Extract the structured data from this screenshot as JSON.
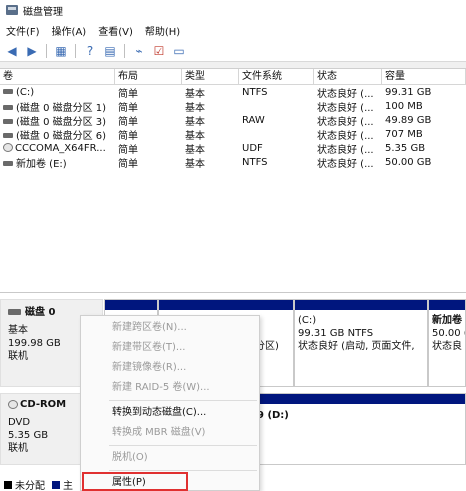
{
  "window": {
    "title": "磁盘管理"
  },
  "menu": [
    "文件(F)",
    "操作(A)",
    "查看(V)",
    "帮助(H)"
  ],
  "toolbar": {
    "icons": [
      "back-arrow-icon",
      "forward-arrow-icon",
      "disk-list-icon",
      "help-icon",
      "properties-icon",
      "connect-icon",
      "checkmark-icon",
      "window-icon"
    ]
  },
  "volume_table": {
    "columns": [
      "卷",
      "布局",
      "类型",
      "文件系统",
      "状态",
      "容量"
    ],
    "rows": [
      {
        "vol": "(C:)",
        "layout": "简单",
        "type": "基本",
        "fs": "NTFS",
        "status": "状态良好 (...",
        "cap": "99.31 GB",
        "icon": "disk"
      },
      {
        "vol": "(磁盘 0 磁盘分区 1)",
        "layout": "简单",
        "type": "基本",
        "fs": "",
        "status": "状态良好 (...",
        "cap": "100 MB",
        "icon": "disk"
      },
      {
        "vol": "(磁盘 0 磁盘分区 3)",
        "layout": "简单",
        "type": "基本",
        "fs": "RAW",
        "status": "状态良好 (...",
        "cap": "49.89 GB",
        "icon": "disk"
      },
      {
        "vol": "(磁盘 0 磁盘分区 6)",
        "layout": "简单",
        "type": "基本",
        "fs": "",
        "status": "状态良好 (...",
        "cap": "707 MB",
        "icon": "disk"
      },
      {
        "vol": "CCCOMA_X64FR...",
        "layout": "简单",
        "type": "基本",
        "fs": "UDF",
        "status": "状态良好 (...",
        "cap": "5.35 GB",
        "icon": "cd"
      },
      {
        "vol": "新加卷 (E:)",
        "layout": "简单",
        "type": "基本",
        "fs": "NTFS",
        "status": "状态良好 (...",
        "cap": "50.00 GB",
        "icon": "disk"
      }
    ]
  },
  "disk0": {
    "name": "磁盘 0",
    "type": "基本",
    "size": "199.98 GB",
    "state": "联机",
    "partitions": [
      {
        "lines": [
          "",
          "",
          "分区)"
        ]
      },
      {
        "lines": [
          "(C:)",
          "99.31 GB NTFS",
          "状态良好 (启动, 页面文件,"
        ]
      },
      {
        "lines": [
          "新加卷",
          "50.00 (",
          "状态良"
        ]
      }
    ]
  },
  "cdrom": {
    "name": "CD-ROM",
    "type": "DVD",
    "size": "5.35 GB",
    "state": "联机",
    "partition_text": "9  (D:)"
  },
  "legend": [
    "未分配",
    "主"
  ],
  "context_menu": {
    "items": [
      {
        "label": "新建跨区卷(N)...",
        "enabled": false
      },
      {
        "label": "新建带区卷(T)...",
        "enabled": false
      },
      {
        "label": "新建镜像卷(R)...",
        "enabled": false
      },
      {
        "label": "新建 RAID-5 卷(W)...",
        "enabled": false
      },
      {
        "label": "转换到动态磁盘(C)...",
        "enabled": true
      },
      {
        "label": "转换成 MBR 磁盘(V)",
        "enabled": false
      },
      {
        "label": "脱机(O)",
        "enabled": false
      },
      {
        "label": "属性(P)",
        "enabled": true
      }
    ]
  },
  "colors": {
    "partition_bar": "#00167e",
    "unallocated": "#000000",
    "primary": "#00167e",
    "highlight": "#e03030"
  }
}
